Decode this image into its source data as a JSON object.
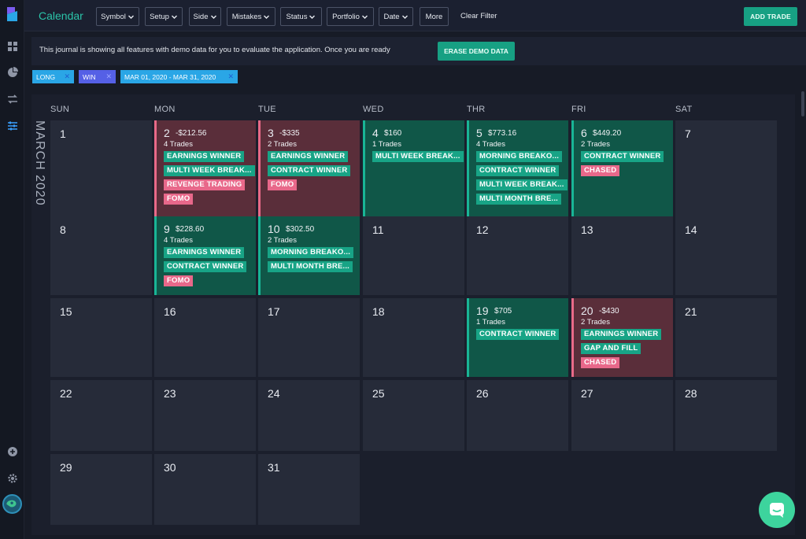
{
  "app": {
    "title": "Calendar"
  },
  "topbar": {
    "filters": [
      "Symbol",
      "Setup",
      "Side",
      "Mistakes",
      "Status",
      "Portfolio",
      "Date"
    ],
    "more_label": "More",
    "clear_filter_label": "Clear Filter",
    "add_trade_label": "ADD TRADE"
  },
  "banner": {
    "text": "This journal is showing all features with demo data for you to evaluate the application. Once you are ready",
    "erase_label": "ERASE DEMO DATA"
  },
  "active_filters": [
    {
      "label": "LONG",
      "remove": "✕"
    },
    {
      "label": "WIN",
      "remove": "✕"
    },
    {
      "label": "MAR 01, 2020 - MAR 31, 2020",
      "remove": "✕"
    }
  ],
  "calendar": {
    "month_label": "MARCH 2020",
    "weekdays": [
      "SUN",
      "MON",
      "TUE",
      "WED",
      "THR",
      "FRI",
      "SAT"
    ],
    "days": [
      {
        "num": "1"
      },
      {
        "num": "2",
        "status": "red",
        "pnl": "-$212.56",
        "trades": "4 Trades",
        "tags": [
          {
            "t": "EARNINGS WINNER",
            "c": "g"
          },
          {
            "t": "MULTI WEEK BREAK...",
            "c": "g"
          },
          {
            "t": "REVENGE TRADING",
            "c": "p"
          },
          {
            "t": "FOMO",
            "c": "p"
          }
        ]
      },
      {
        "num": "3",
        "status": "red",
        "pnl": "-$335",
        "trades": "2 Trades",
        "tags": [
          {
            "t": "EARNINGS WINNER",
            "c": "g"
          },
          {
            "t": "CONTRACT WINNER",
            "c": "g"
          },
          {
            "t": "FOMO",
            "c": "p"
          }
        ]
      },
      {
        "num": "4",
        "status": "green",
        "pnl": "$160",
        "trades": "1 Trades",
        "tags": [
          {
            "t": "MULTI WEEK BREAK...",
            "c": "g"
          }
        ]
      },
      {
        "num": "5",
        "status": "green",
        "pnl": "$773.16",
        "trades": "4 Trades",
        "tags": [
          {
            "t": "MORNING BREAKO...",
            "c": "g"
          },
          {
            "t": "CONTRACT WINNER",
            "c": "g"
          },
          {
            "t": "MULTI WEEK BREAK...",
            "c": "g"
          },
          {
            "t": "MULTI MONTH BRE...",
            "c": "g"
          }
        ]
      },
      {
        "num": "6",
        "status": "green",
        "pnl": "$449.20",
        "trades": "2 Trades",
        "tags": [
          {
            "t": "CONTRACT WINNER",
            "c": "g"
          },
          {
            "t": "CHASED",
            "c": "p"
          }
        ]
      },
      {
        "num": "7"
      },
      {
        "num": "8"
      },
      {
        "num": "9",
        "status": "green",
        "pnl": "$228.60",
        "trades": "4 Trades",
        "tags": [
          {
            "t": "EARNINGS WINNER",
            "c": "g"
          },
          {
            "t": "CONTRACT WINNER",
            "c": "g"
          },
          {
            "t": "FOMO",
            "c": "p"
          }
        ]
      },
      {
        "num": "10",
        "status": "green",
        "pnl": "$302.50",
        "trades": "2 Trades",
        "tags": [
          {
            "t": "MORNING BREAKO...",
            "c": "g"
          },
          {
            "t": "MULTI MONTH BRE...",
            "c": "g"
          }
        ]
      },
      {
        "num": "11"
      },
      {
        "num": "12"
      },
      {
        "num": "13"
      },
      {
        "num": "14"
      },
      {
        "num": "15"
      },
      {
        "num": "16"
      },
      {
        "num": "17"
      },
      {
        "num": "18"
      },
      {
        "num": "19",
        "status": "green",
        "pnl": "$705",
        "trades": "1 Trades",
        "tags": [
          {
            "t": "CONTRACT WINNER",
            "c": "g"
          }
        ]
      },
      {
        "num": "20",
        "status": "red",
        "pnl": "-$430",
        "trades": "2 Trades",
        "tags": [
          {
            "t": "EARNINGS WINNER",
            "c": "g"
          },
          {
            "t": "GAP AND FILL",
            "c": "g"
          },
          {
            "t": "CHASED",
            "c": "p"
          }
        ]
      },
      {
        "num": "21"
      },
      {
        "num": "22"
      },
      {
        "num": "23"
      },
      {
        "num": "24"
      },
      {
        "num": "25"
      },
      {
        "num": "26"
      },
      {
        "num": "27"
      },
      {
        "num": "28"
      },
      {
        "num": "29"
      },
      {
        "num": "30"
      },
      {
        "num": "31"
      }
    ]
  },
  "colors": {
    "accent": "#17a083",
    "loss_bg": "#5a2e3a",
    "win_bg": "#105748",
    "win_tag": "#18a486",
    "mistake_tag": "#e8688a"
  }
}
